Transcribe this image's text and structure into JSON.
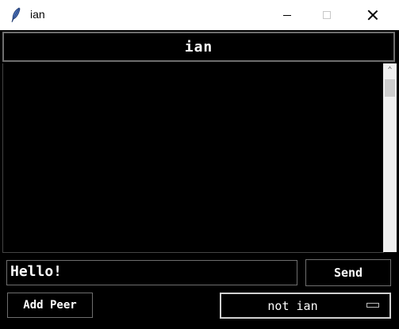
{
  "window": {
    "title": "ian",
    "icon": "feather-icon"
  },
  "header": {
    "title": "ian"
  },
  "messages": [],
  "composer": {
    "message_value": "Hello!",
    "send_label": "Send"
  },
  "peers": {
    "add_label": "Add Peer",
    "selected": "not ian"
  }
}
